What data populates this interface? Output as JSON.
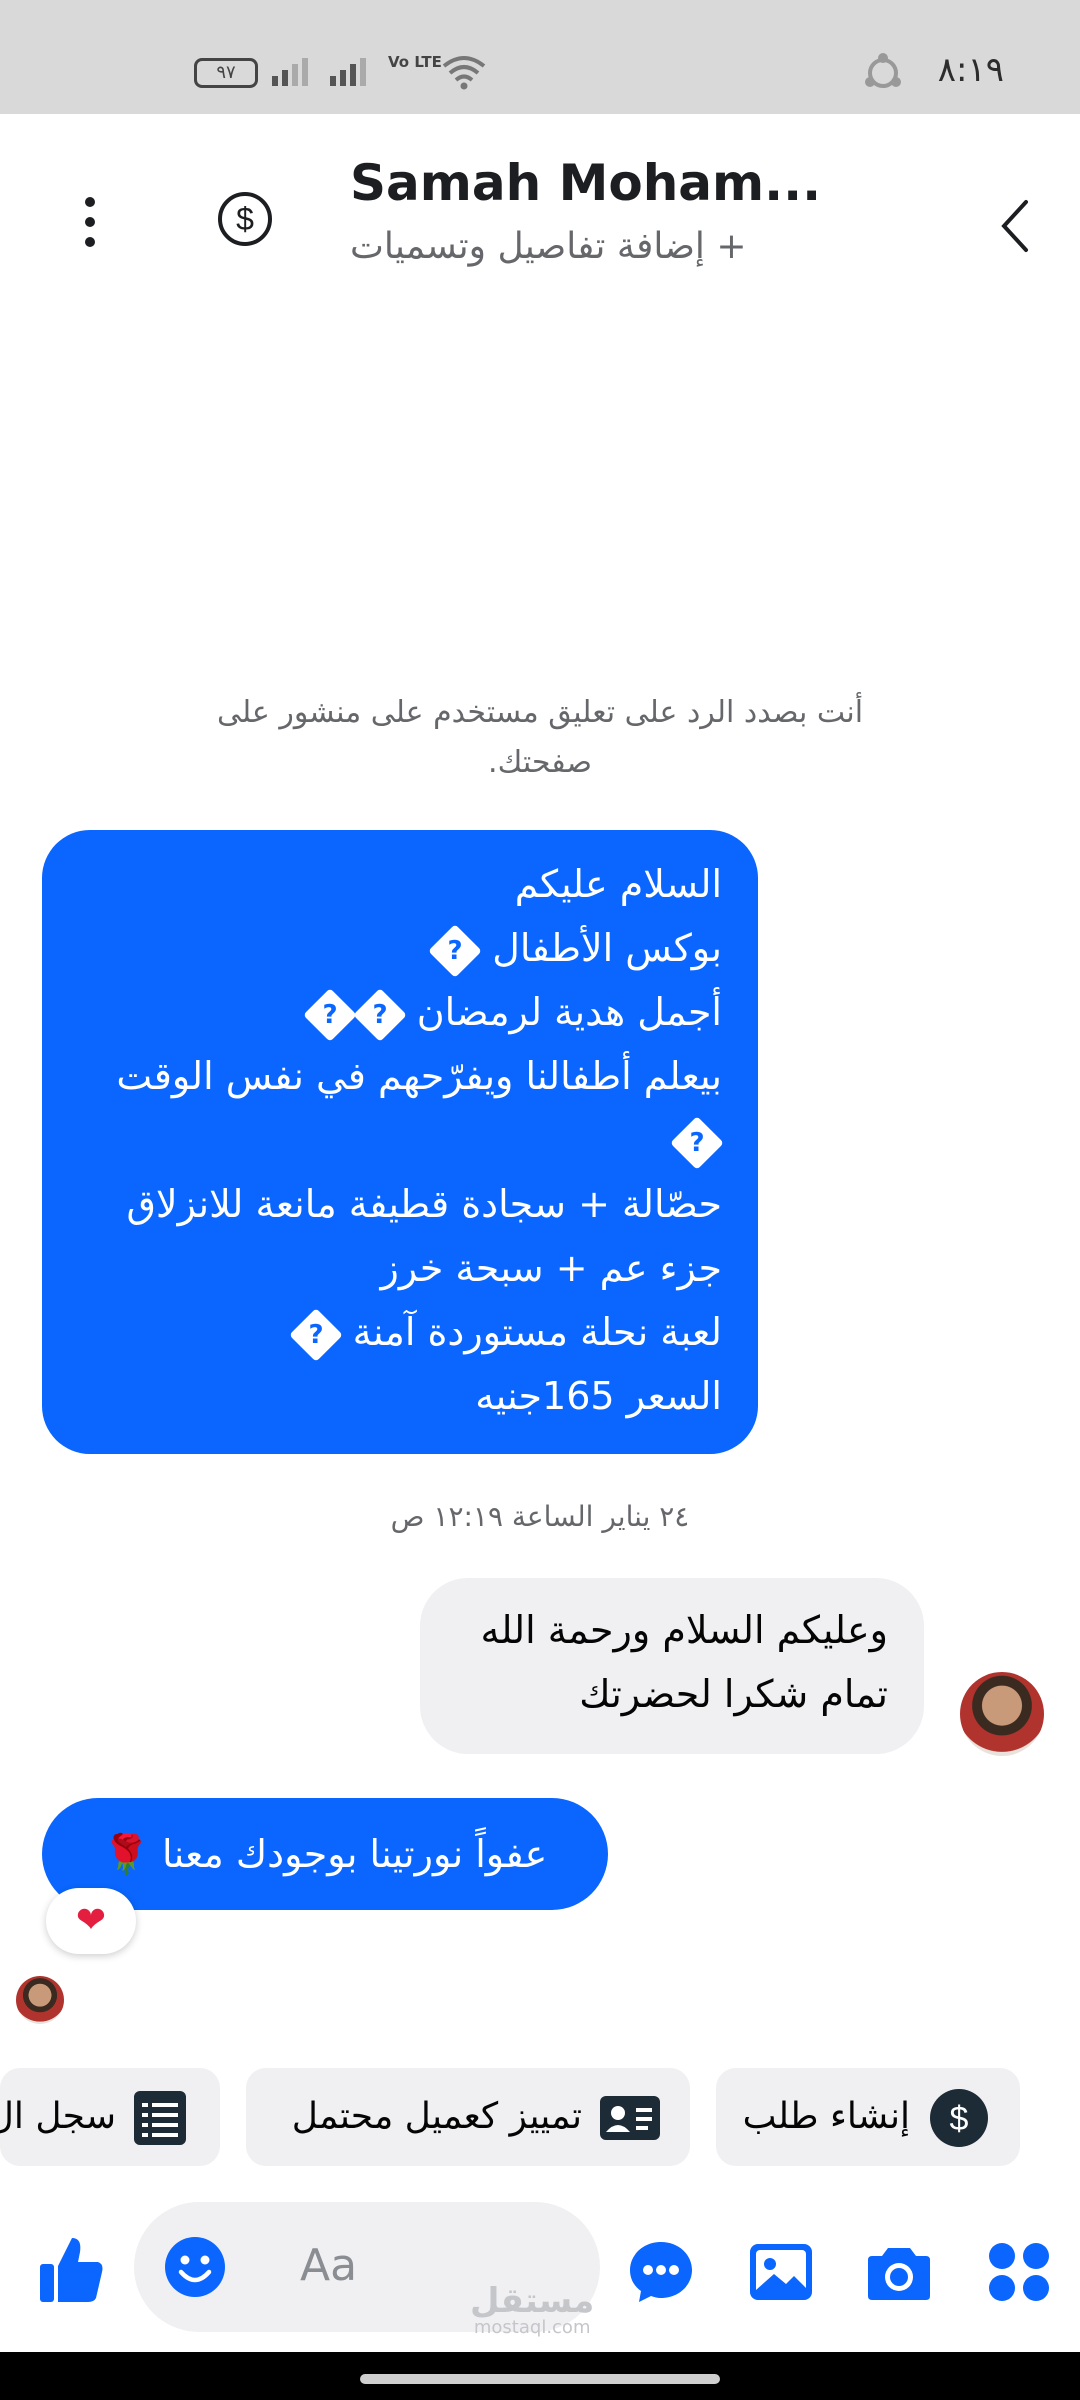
{
  "status_bar": {
    "time": "٨:١٩",
    "battery": "٩٧",
    "network": "Vo LTE"
  },
  "header": {
    "contact_name": "Samah Moham...",
    "subtitle": "+ إضافة تفاصيل وتسميات"
  },
  "conversation": {
    "notice": "أنت بصدد الرد على تعليق مستخدم على منشور على صفحتك.",
    "incoming_lines": [
      "السلام عليكم",
      "بوكس الأطفال",
      "أجمل هدية لرمضان",
      "بيعلم أطفالنا ويفرّحهم في نفس الوقت",
      "حصّالة + سجادة قطيفة مانعة للانزلاق",
      "جزء عم + سبحة خرز",
      "لعبة نحلة مستوردة آمنة",
      "السعر 165جنيه"
    ],
    "unknown_glyph": "?",
    "timestamp": "٢٤ يناير الساعة ١٢:١٩ ص",
    "reply_lines": [
      "وعليكم السلام ورحمة الله",
      "تمام شكرا لحضرتك"
    ],
    "final_message": "عفواً نورتينا بوجودك معنا 🌹",
    "reaction": "❤"
  },
  "quick_actions": {
    "create_order": "إنشاء طلب",
    "tag_lead": "تمييز كعميل محتمل",
    "history": "سجل ال"
  },
  "composer": {
    "placeholder": "Aa"
  },
  "watermark": {
    "arabic": "مستقل",
    "latin": "mostaql.com"
  },
  "colors": {
    "accent": "#0a66ff",
    "bubble_gray": "#f0f0f2",
    "status_bar": "#d9d9d9"
  }
}
